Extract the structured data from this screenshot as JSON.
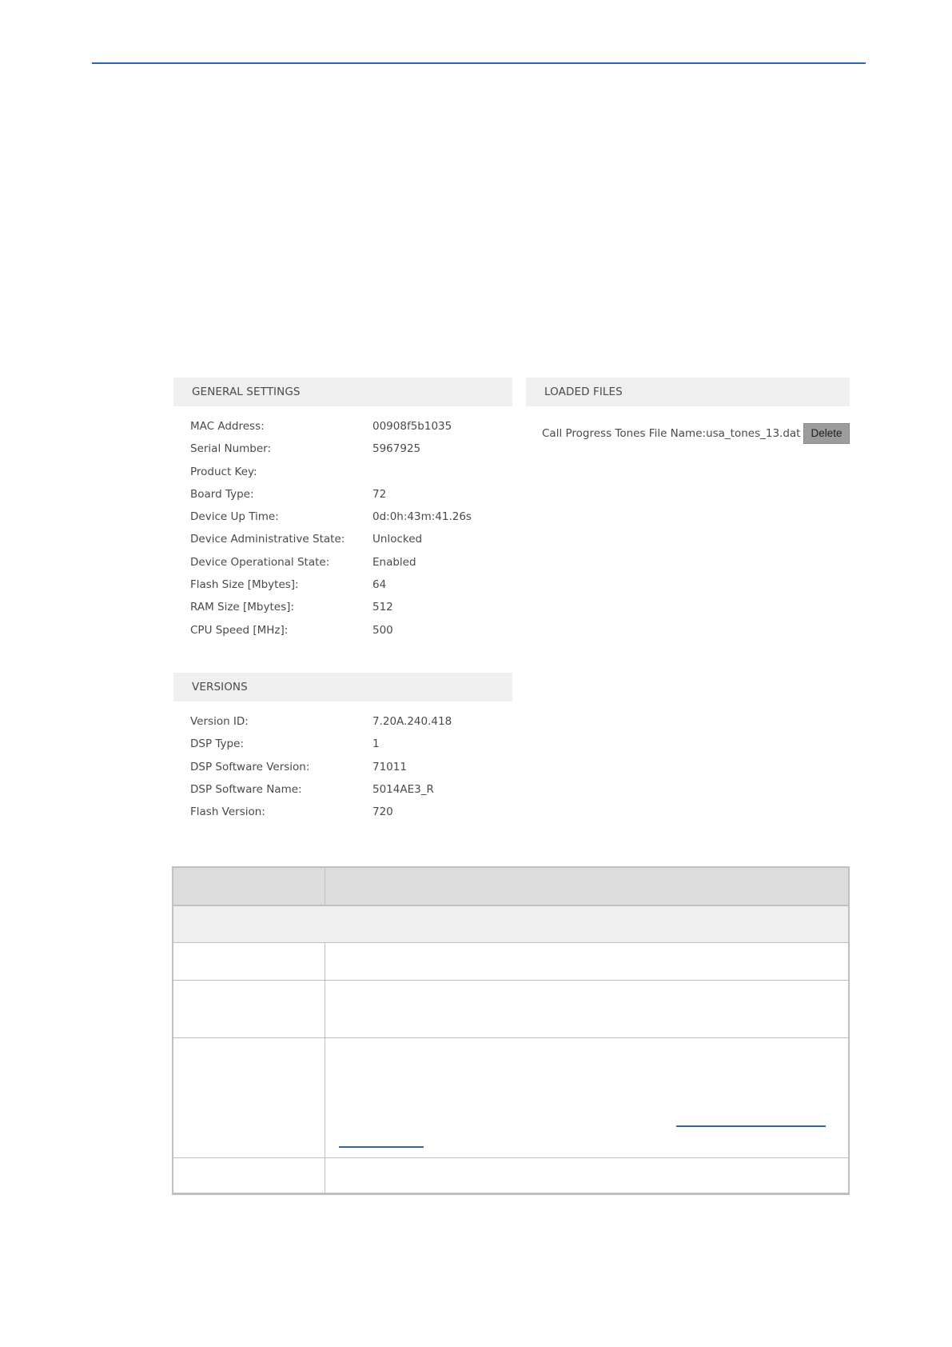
{
  "general_settings": {
    "header": "GENERAL SETTINGS",
    "rows": [
      {
        "label": "MAC Address:",
        "value": "00908f5b1035"
      },
      {
        "label": "Serial Number:",
        "value": "5967925"
      },
      {
        "label": "Product Key:",
        "value": ""
      },
      {
        "label": "Board Type:",
        "value": "72"
      },
      {
        "label": "Device Up Time:",
        "value": "0d:0h:43m:41.26s"
      },
      {
        "label": "Device Administrative State:",
        "value": "Unlocked"
      },
      {
        "label": "Device Operational State:",
        "value": "Enabled"
      },
      {
        "label": "Flash Size [Mbytes]:",
        "value": "64"
      },
      {
        "label": "RAM Size [Mbytes]:",
        "value": "512"
      },
      {
        "label": "CPU Speed [MHz]:",
        "value": "500"
      }
    ]
  },
  "versions": {
    "header": "VERSIONS",
    "rows": [
      {
        "label": "Version ID:",
        "value": "7.20A.240.418"
      },
      {
        "label": "DSP Type:",
        "value": "1"
      },
      {
        "label": "DSP Software Version:",
        "value": "71011"
      },
      {
        "label": "DSP Software Name:",
        "value": "5014AE3_R"
      },
      {
        "label": "Flash Version:",
        "value": "720"
      }
    ]
  },
  "loaded_files": {
    "header": "LOADED FILES",
    "file_label": "Call Progress Tones File Name:",
    "file_name": "usa_tones_13.dat",
    "delete_label": "Delete"
  },
  "colors": {
    "accent_rule": "#2e63b8",
    "panel_header_bg": "#efefef",
    "table_header_bg": "#dcdcdc",
    "delete_button_bg": "#9c9c9c"
  }
}
